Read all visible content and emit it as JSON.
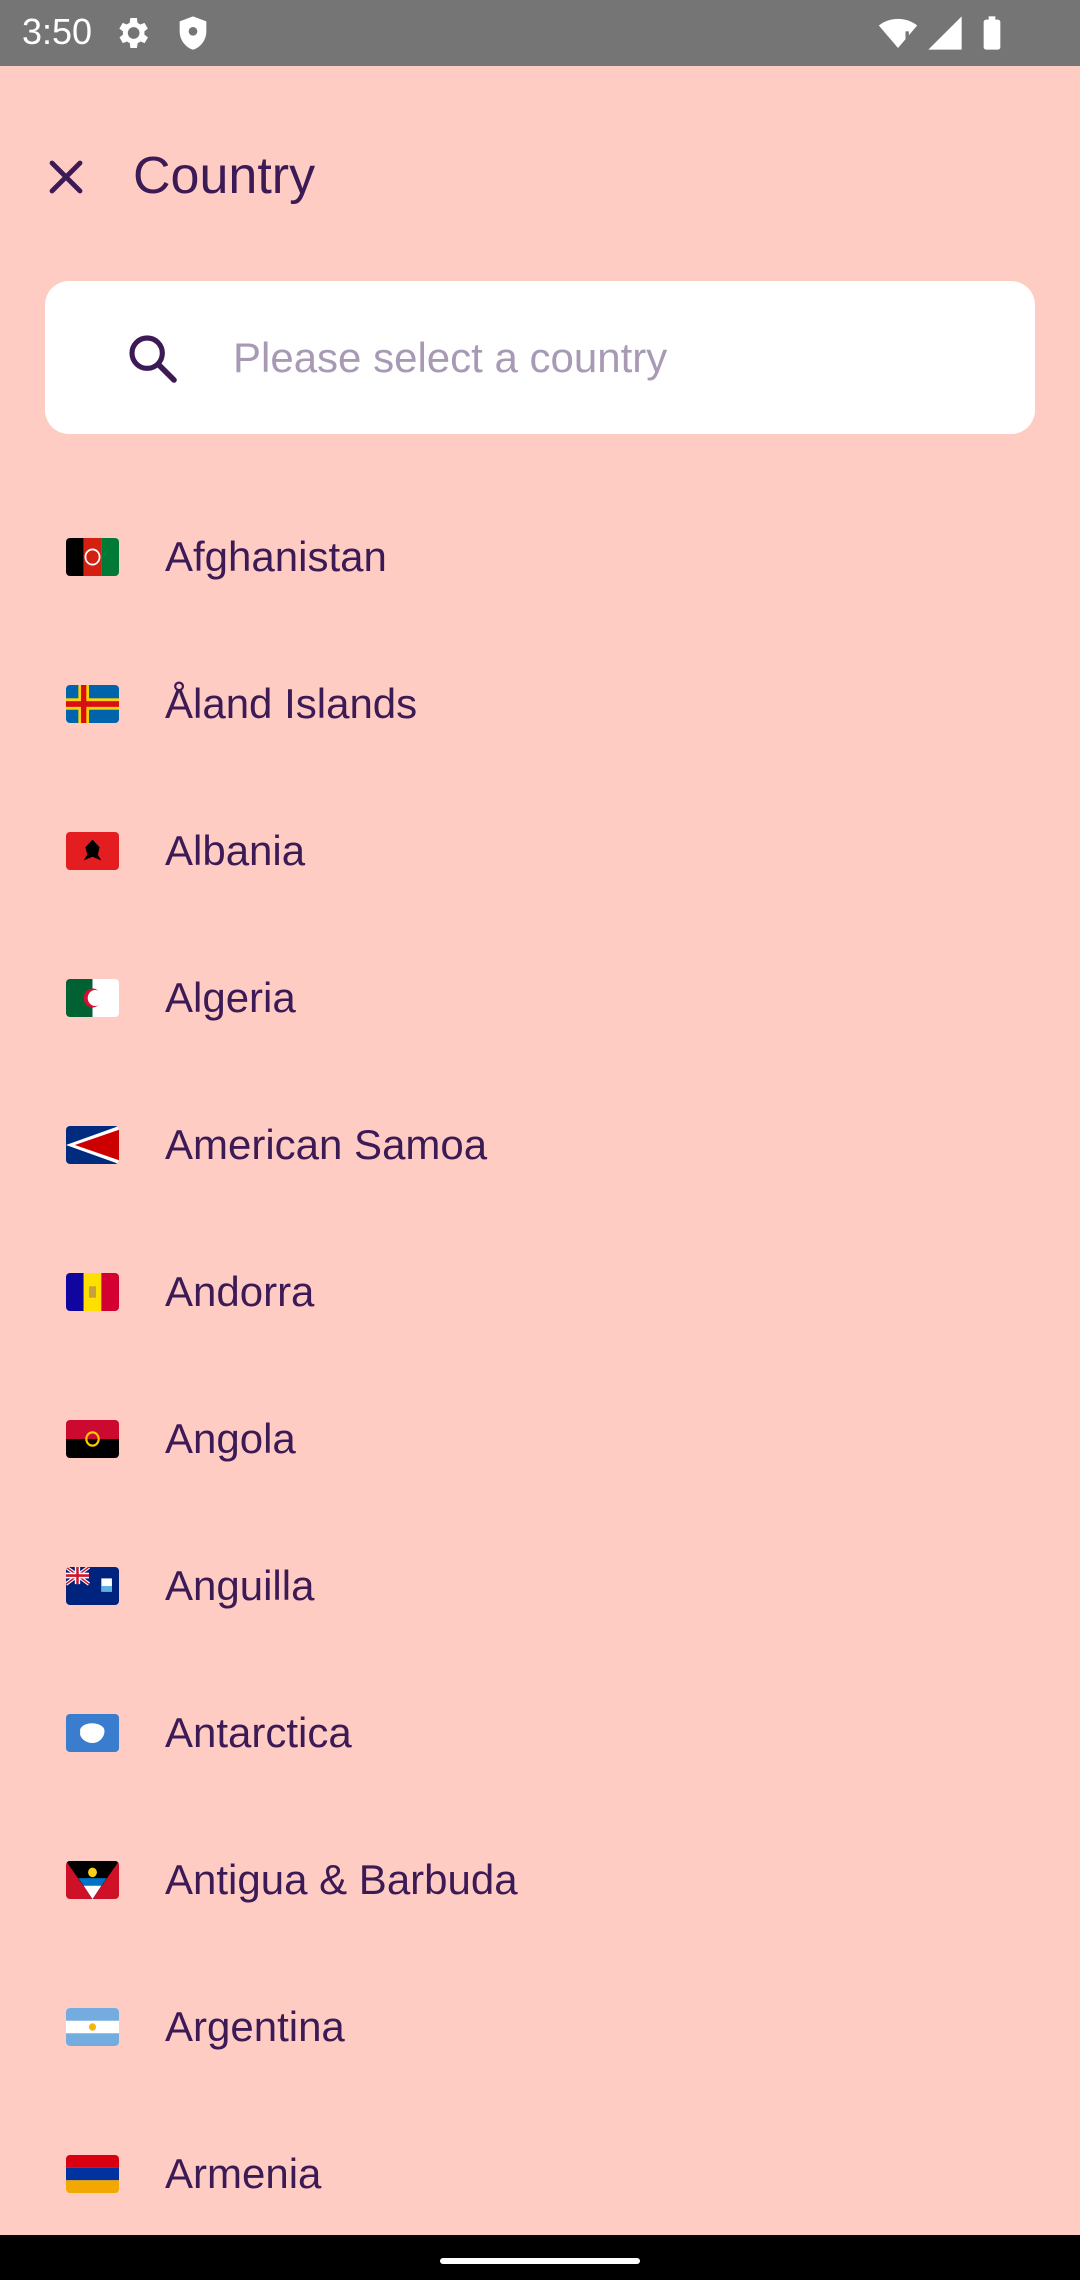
{
  "status_bar": {
    "time": "3:50",
    "icons": [
      "gear-icon",
      "shield-icon",
      "wifi-icon",
      "signal-icon",
      "battery-icon"
    ]
  },
  "header": {
    "title": "Country",
    "close_icon": "close-icon"
  },
  "search": {
    "placeholder": "Please select a country",
    "value": "",
    "icon": "search-icon"
  },
  "countries": [
    {
      "name": "Afghanistan",
      "flag": "flag-afghanistan-icon"
    },
    {
      "name": "Åland Islands",
      "flag": "flag-aland-islands-icon"
    },
    {
      "name": "Albania",
      "flag": "flag-albania-icon"
    },
    {
      "name": "Algeria",
      "flag": "flag-algeria-icon"
    },
    {
      "name": "American Samoa",
      "flag": "flag-american-samoa-icon"
    },
    {
      "name": "Andorra",
      "flag": "flag-andorra-icon"
    },
    {
      "name": "Angola",
      "flag": "flag-angola-icon"
    },
    {
      "name": "Anguilla",
      "flag": "flag-anguilla-icon"
    },
    {
      "name": "Antarctica",
      "flag": "flag-antarctica-icon"
    },
    {
      "name": "Antigua & Barbuda",
      "flag": "flag-antigua-barbuda-icon"
    },
    {
      "name": "Argentina",
      "flag": "flag-argentina-icon"
    },
    {
      "name": "Armenia",
      "flag": "flag-armenia-icon"
    }
  ],
  "colors": {
    "background": "#ffccc4",
    "text": "#3b1a55",
    "status_bar": "#757575",
    "search_field": "#ffffff",
    "placeholder": "#a89ab4"
  }
}
